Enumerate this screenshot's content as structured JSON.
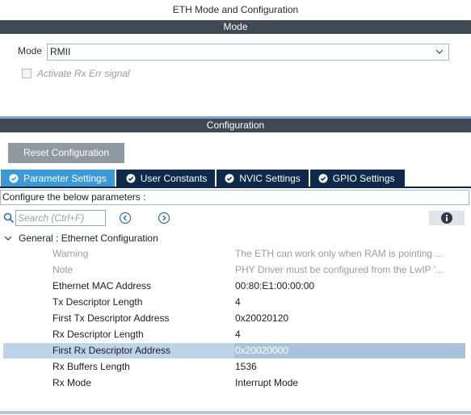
{
  "window": {
    "title": "ETH Mode and Configuration"
  },
  "mode_section": {
    "header": "Mode",
    "mode_label": "Mode",
    "mode_value": "RMII",
    "checkbox_label": "Activate Rx Err signal"
  },
  "config_section": {
    "header": "Configuration",
    "reset_button": "Reset Configuration",
    "tabs": [
      {
        "label": "Parameter Settings",
        "active": true
      },
      {
        "label": "User Constants",
        "active": false
      },
      {
        "label": "NVIC Settings",
        "active": false
      },
      {
        "label": "GPIO Settings",
        "active": false
      }
    ],
    "hint": "Configure the below parameters :",
    "search_placeholder": "Search (Ctrl+F)",
    "group_label": "General : Ethernet Configuration",
    "params": [
      {
        "name": "Warning",
        "value": "The ETH can work only when RAM is pointing ...",
        "dim": true
      },
      {
        "name": "Note",
        "value": "PHY Driver must be configured from the LwIP '...",
        "dim": true
      },
      {
        "name": "Ethernet MAC Address",
        "value": "00:80:E1:00:00:00"
      },
      {
        "name": "Tx Descriptor Length",
        "value": "4"
      },
      {
        "name": "First Tx Descriptor Address",
        "value": "0x20020120"
      },
      {
        "name": "Rx Descriptor Length",
        "value": "4"
      },
      {
        "name": "First Rx Descriptor Address",
        "value": "0x20020000",
        "selected": true
      },
      {
        "name": "Rx Buffers Length",
        "value": "1536"
      },
      {
        "name": "Rx Mode",
        "value": "Interrupt Mode"
      }
    ]
  },
  "colors": {
    "section_bar": "#3f4a55",
    "active_tab": "#3a9ad9",
    "inactive_tab": "#0d2a4b",
    "selection": "#bcd3e8"
  },
  "icons": {
    "select_chevron": "chevron-down-icon",
    "tab_check": "check-circle-icon",
    "search": "search-icon",
    "prev": "chevron-circle-left-icon",
    "next": "chevron-circle-right-icon",
    "info": "info-icon",
    "group_toggle": "chevron-down-icon"
  }
}
